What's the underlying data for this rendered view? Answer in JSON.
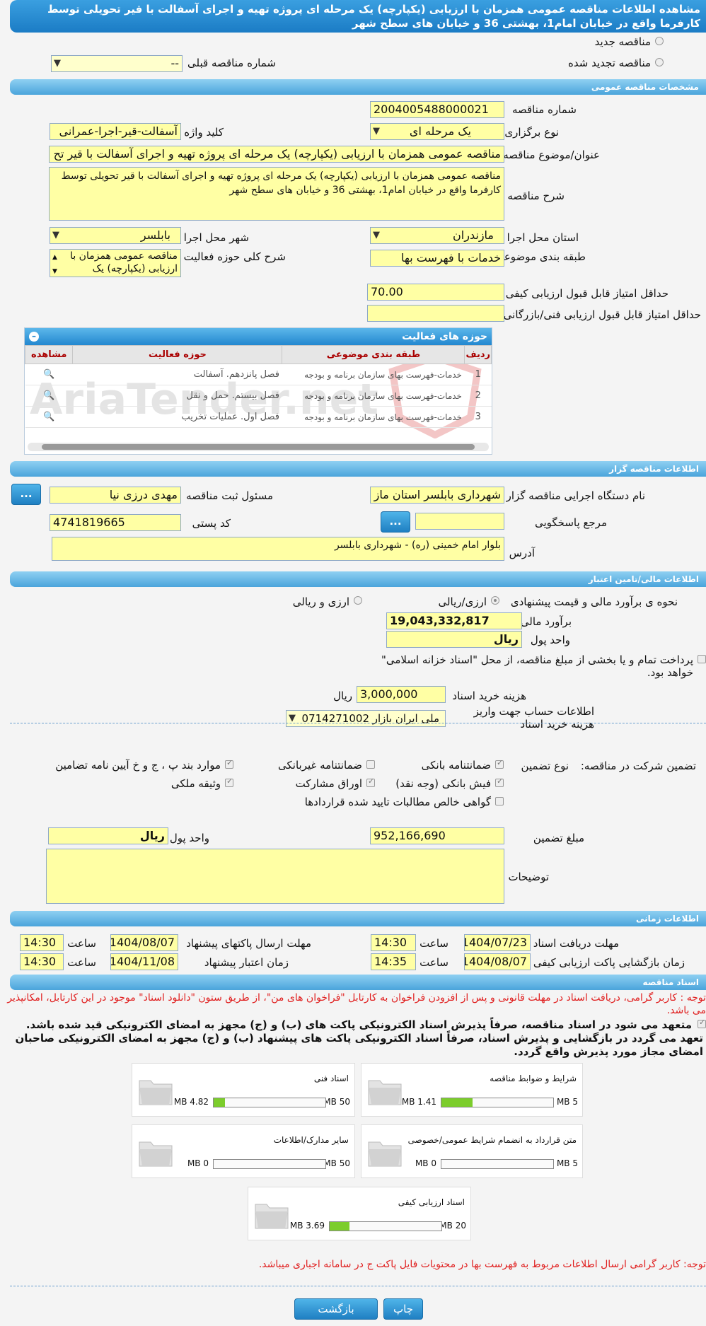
{
  "header": {
    "title": "مشاهده اطلاعات مناقصه عمومی همزمان با ارزیابی (یکپارچه) یک مرحله ای پروژه تهیه و اجرای آسفالت با قیر تحویلی توسط کارفرما واقع در خیابان امام1، بهشتی 36 و خیابان های سطح شهر"
  },
  "tender_type": {
    "new_label": "مناقصه جدید",
    "renewed_label": "مناقصه تجدید شده",
    "previous_number_label": "شماره مناقصه قبلی",
    "previous_number_value": "--"
  },
  "sections": {
    "general": "مشخصات مناقصه عمومی",
    "organizer": "اطلاعات مناقصه گزار",
    "finance": "اطلاعات مالی/تامین اعتبار",
    "timing": "اطلاعات زمانی",
    "documents": "اسناد مناقصه"
  },
  "general": {
    "number_label": "شماره مناقصه",
    "number_value": "2004005488000021",
    "holding_type_label": "نوع برگزاری",
    "holding_type_value": "یک مرحله ای",
    "keyword_label": "کلید واژه",
    "keyword_value": "آسفالت-قیر-اجرا-عمرانی",
    "subject_label": "عنوان/موضوع مناقصه",
    "subject_value": "مناقصه عمومی همزمان با ارزیابی (یکپارچه) یک مرحله ای پروژه تهیه و اجرای آسفالت با قیر تح",
    "description_label": "شرح مناقصه",
    "description_value": "مناقصه عمومی همزمان با ارزیابی (یکپارچه) یک مرحله ای پروژه تهیه و اجرای آسفالت با قیر تحویلی توسط کارفرما واقع در خیابان امام1، بهشتی 36 و خیابان های سطح شهر",
    "province_label": "استان محل اجرا",
    "province_value": "مازندران",
    "city_label": "شهر محل اجرا",
    "city_value": "بابلسر",
    "category_label": "طبقه بندی موضوعی",
    "category_value": "خدمات با فهرست بها",
    "activity_desc_label": "شرح کلی حوزه فعالیت",
    "activity_desc_value": "مناقصه عمومی همزمان با ارزیابی (یکپارچه) یک",
    "min_quality_label": "حداقل امتیاز قابل قبول ارزیابی کیفی",
    "min_quality_value": "70.00",
    "min_tech_label": "حداقل امتیاز قابل قبول ارزیابی فنی/بازرگانی",
    "min_tech_value": ""
  },
  "activity_table": {
    "title": "حوزه های فعالیت",
    "headers": [
      "ردیف",
      "طبقه بندی موضوعی",
      "حوزه فعالیت",
      "مشاهده"
    ],
    "rows": [
      {
        "n": "1",
        "category": "خدمات-فهرست بهای سازمان برنامه و بودجه",
        "activity": "فصل پانزدهم. آسفالت"
      },
      {
        "n": "2",
        "category": "خدمات-فهرست بهای سازمان برنامه و بودجه",
        "activity": "فصل بیستم. حمل و نقل"
      },
      {
        "n": "3",
        "category": "خدمات-فهرست بهای سازمان برنامه و بودجه",
        "activity": "فصل اول. عملیات تخریب"
      }
    ]
  },
  "organizer": {
    "agency_label": "نام دستگاه اجرایی مناقصه گزار",
    "agency_value": "شهرداری بابلسر استان ماز",
    "registrar_label": "مسئول ثبت مناقصه",
    "registrar_value": "مهدی درزی نیا",
    "responder_label": "مرجع پاسخگویی",
    "responder_value": "",
    "postal_label": "کد پستی",
    "postal_value": "4741819665",
    "address_label": "آدرس",
    "address_value": "بلوار امام خمینی (ره) - شهرداری بابلسر",
    "dots": "..."
  },
  "finance": {
    "estimate_type_label": "نحوه ی برآورد مالی و قیمت پیشنهادی",
    "opt1": "ارزی/ریالی",
    "opt2": "ارزی و ریالی",
    "estimate_label": "برآورد مالی",
    "estimate_value": "19,043,332,817",
    "currency_label": "واحد پول",
    "currency_value": "ریال",
    "treasury_label": "پرداخت تمام و یا بخشی از مبلغ مناقصه، از محل \"اسناد خزانه اسلامی\" خواهد بود.",
    "doc_cost_label": "هزینه خرید اسناد",
    "doc_cost_value": "3,000,000",
    "doc_cost_unit": "ریال",
    "account_label": "اطلاعات حساب جهت واریز هزینه خرید اسناد",
    "account_value": "ملی ایران بازار 0714271002"
  },
  "guarantee": {
    "label": "تضمین شرکت در مناقصه:",
    "type_label": "نوع تضمین",
    "options": [
      "ضمانتنامه بانکی",
      "ضمانتنامه غیربانکی",
      "موارد بند پ ، ج و خ آیین نامه تضامین",
      "فیش بانکی (وجه نقد)",
      "اوراق مشارکت",
      "وثیقه ملکی",
      "گواهی خالص مطالبات تایید شده قراردادها"
    ],
    "amount_label": "مبلغ تضمین",
    "amount_value": "952,166,690",
    "currency_label": "واحد پول",
    "currency_value": "ریال",
    "notes_label": "توضیحات",
    "notes_value": ""
  },
  "timing": {
    "doc_receive_label": "مهلت دریافت اسناد",
    "doc_receive_date": "1404/07/23",
    "doc_receive_time": "14:30",
    "send_label": "مهلت ارسال پاکتهای پیشنهاد",
    "send_date": "1404/08/07",
    "send_time": "14:30",
    "open_label": "زمان بازگشایی پاکت ارزیابی کیفی",
    "open_date": "1404/08/07",
    "open_time": "14:35",
    "validity_label": "زمان اعتبار پیشنهاد",
    "validity_date": "1404/11/08",
    "validity_time": "14:30",
    "time_label": "ساعت"
  },
  "documents": {
    "note": "توجه : کاربر گرامی، دریافت اسناد در مهلت قانونی و پس از افزودن فراخوان به کارتابل \"فراخوان های من\"، از طریق ستون \"دانلود اسناد\" موجود در این کارتابل، امکانپذیر می باشد.",
    "commit": "متعهد می شود در اسناد مناقصه، صرفاً پذیرش اسناد الکترونیکی پاکت های (ب) و (ج) مجهز به امضای الکترونیکی قید شده باشد. تعهد می گردد در بازگشایی و پذیرش اسناد، صرفاً اسناد الکترونیکی پاکت های پیشنهاد (ب) و (ج) مجهز به امضای الکترونیکی صاحبان امضای مجاز مورد پذیرش واقع گردد.",
    "items": [
      {
        "name": "شرایط و ضوابط مناقصه",
        "used": "1.41 MB",
        "max": "5 MB",
        "fraction": 0.28
      },
      {
        "name": "اسناد فنی",
        "used": "4.82 MB",
        "max": "50 MB",
        "fraction": 0.1
      },
      {
        "name": "متن قرارداد به انضمام شرایط عمومی/خصوصی",
        "used": "0 MB",
        "max": "5 MB",
        "fraction": 0
      },
      {
        "name": "سایر مدارک/اطلاعات",
        "used": "0 MB",
        "max": "50 MB",
        "fraction": 0
      },
      {
        "name": "اسناد ارزیابی کیفی",
        "used": "3.69 MB",
        "max": "20 MB",
        "fraction": 0.18
      }
    ],
    "footer_note": "توجه: کاربر گرامی ارسال اطلاعات مربوط به فهرست بها در محتویات فایل پاکت ج در سامانه اجباری میباشد."
  },
  "buttons": {
    "print": "چاپ",
    "back": "بازگشت"
  },
  "watermark": "AriaTender.net"
}
